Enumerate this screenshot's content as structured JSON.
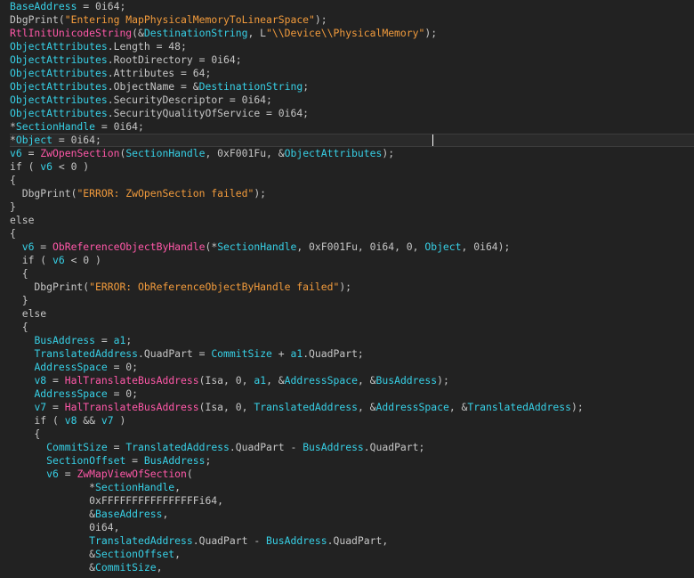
{
  "lines": [
    [
      [
        "BaseAddress",
        "var"
      ],
      [
        " = 0i64;",
        "plain"
      ]
    ],
    [
      [
        "DbgPrint",
        "plain"
      ],
      [
        "(",
        "plain"
      ],
      [
        "\"Entering MapPhysicalMemoryToLinearSpace\"",
        "str"
      ],
      [
        ");",
        "plain"
      ]
    ],
    [
      [
        "RtlInitUnicodeString",
        "func"
      ],
      [
        "(&",
        "plain"
      ],
      [
        "DestinationString",
        "var"
      ],
      [
        ", L",
        "plain"
      ],
      [
        "\"\\\\Device\\\\PhysicalMemory\"",
        "str"
      ],
      [
        ");",
        "plain"
      ]
    ],
    [
      [
        "ObjectAttributes",
        "var"
      ],
      [
        ".Length = 48;",
        "plain"
      ]
    ],
    [
      [
        "ObjectAttributes",
        "var"
      ],
      [
        ".RootDirectory = 0i64;",
        "plain"
      ]
    ],
    [
      [
        "ObjectAttributes",
        "var"
      ],
      [
        ".Attributes = 64;",
        "plain"
      ]
    ],
    [
      [
        "ObjectAttributes",
        "var"
      ],
      [
        ".ObjectName = &",
        "plain"
      ],
      [
        "DestinationString",
        "var"
      ],
      [
        ";",
        "plain"
      ]
    ],
    [
      [
        "ObjectAttributes",
        "var"
      ],
      [
        ".SecurityDescriptor = 0i64;",
        "plain"
      ]
    ],
    [
      [
        "ObjectAttributes",
        "var"
      ],
      [
        ".SecurityQualityOfService = 0i64;",
        "plain"
      ]
    ],
    [
      [
        "*",
        "plain"
      ],
      [
        "SectionHandle",
        "var"
      ],
      [
        " = 0i64;",
        "plain"
      ]
    ],
    [
      [
        "*",
        "plain"
      ],
      [
        "Object",
        "var"
      ],
      [
        " = 0i64;",
        "plain"
      ]
    ],
    [
      [
        "v6",
        "var"
      ],
      [
        " = ",
        "plain"
      ],
      [
        "ZwOpenSection",
        "func"
      ],
      [
        "(",
        "plain"
      ],
      [
        "SectionHandle",
        "var"
      ],
      [
        ", 0xF001Fu, &",
        "plain"
      ],
      [
        "ObjectAttributes",
        "var"
      ],
      [
        ");",
        "plain"
      ]
    ],
    [
      [
        "if ( ",
        "plain"
      ],
      [
        "v6",
        "var"
      ],
      [
        " < 0 )",
        "plain"
      ]
    ],
    [
      [
        "{",
        "plain"
      ]
    ],
    [
      [
        "  DbgPrint(",
        "plain"
      ],
      [
        "\"ERROR: ZwOpenSection failed\"",
        "str"
      ],
      [
        ");",
        "plain"
      ]
    ],
    [
      [
        "}",
        "plain"
      ]
    ],
    [
      [
        "else",
        "plain"
      ]
    ],
    [
      [
        "{",
        "plain"
      ]
    ],
    [
      [
        "  ",
        "plain"
      ],
      [
        "v6",
        "var"
      ],
      [
        " = ",
        "plain"
      ],
      [
        "ObReferenceObjectByHandle",
        "func"
      ],
      [
        "(*",
        "plain"
      ],
      [
        "SectionHandle",
        "var"
      ],
      [
        ", 0xF001Fu, 0i64, 0, ",
        "plain"
      ],
      [
        "Object",
        "var"
      ],
      [
        ", 0i64);",
        "plain"
      ]
    ],
    [
      [
        "  if ( ",
        "plain"
      ],
      [
        "v6",
        "var"
      ],
      [
        " < 0 )",
        "plain"
      ]
    ],
    [
      [
        "  {",
        "plain"
      ]
    ],
    [
      [
        "    DbgPrint(",
        "plain"
      ],
      [
        "\"ERROR: ObReferenceObjectByHandle failed\"",
        "str"
      ],
      [
        ");",
        "plain"
      ]
    ],
    [
      [
        "  }",
        "plain"
      ]
    ],
    [
      [
        "  else",
        "plain"
      ]
    ],
    [
      [
        "  {",
        "plain"
      ]
    ],
    [
      [
        "    ",
        "plain"
      ],
      [
        "BusAddress",
        "var"
      ],
      [
        " = ",
        "plain"
      ],
      [
        "a1",
        "var"
      ],
      [
        ";",
        "plain"
      ]
    ],
    [
      [
        "    ",
        "plain"
      ],
      [
        "TranslatedAddress",
        "var"
      ],
      [
        ".QuadPart = ",
        "plain"
      ],
      [
        "CommitSize",
        "var"
      ],
      [
        " + ",
        "plain"
      ],
      [
        "a1",
        "var"
      ],
      [
        ".QuadPart;",
        "plain"
      ]
    ],
    [
      [
        "    ",
        "plain"
      ],
      [
        "AddressSpace",
        "var"
      ],
      [
        " = 0;",
        "plain"
      ]
    ],
    [
      [
        "    ",
        "plain"
      ],
      [
        "v8",
        "var"
      ],
      [
        " = ",
        "plain"
      ],
      [
        "HalTranslateBusAddress",
        "func"
      ],
      [
        "(Isa, 0, ",
        "plain"
      ],
      [
        "a1",
        "var"
      ],
      [
        ", &",
        "plain"
      ],
      [
        "AddressSpace",
        "var"
      ],
      [
        ", &",
        "plain"
      ],
      [
        "BusAddress",
        "var"
      ],
      [
        ");",
        "plain"
      ]
    ],
    [
      [
        "    ",
        "plain"
      ],
      [
        "AddressSpace",
        "var"
      ],
      [
        " = 0;",
        "plain"
      ]
    ],
    [
      [
        "    ",
        "plain"
      ],
      [
        "v7",
        "var"
      ],
      [
        " = ",
        "plain"
      ],
      [
        "HalTranslateBusAddress",
        "func"
      ],
      [
        "(Isa, 0, ",
        "plain"
      ],
      [
        "TranslatedAddress",
        "var"
      ],
      [
        ", &",
        "plain"
      ],
      [
        "AddressSpace",
        "var"
      ],
      [
        ", &",
        "plain"
      ],
      [
        "TranslatedAddress",
        "var"
      ],
      [
        ");",
        "plain"
      ]
    ],
    [
      [
        "    if ( ",
        "plain"
      ],
      [
        "v8",
        "var"
      ],
      [
        " && ",
        "plain"
      ],
      [
        "v7",
        "var"
      ],
      [
        " )",
        "plain"
      ]
    ],
    [
      [
        "    {",
        "plain"
      ]
    ],
    [
      [
        "      ",
        "plain"
      ],
      [
        "CommitSize",
        "var"
      ],
      [
        " = ",
        "plain"
      ],
      [
        "TranslatedAddress",
        "var"
      ],
      [
        ".QuadPart - ",
        "plain"
      ],
      [
        "BusAddress",
        "var"
      ],
      [
        ".QuadPart;",
        "plain"
      ]
    ],
    [
      [
        "      ",
        "plain"
      ],
      [
        "SectionOffset",
        "var"
      ],
      [
        " = ",
        "plain"
      ],
      [
        "BusAddress",
        "var"
      ],
      [
        ";",
        "plain"
      ]
    ],
    [
      [
        "      ",
        "plain"
      ],
      [
        "v6",
        "var"
      ],
      [
        " = ",
        "plain"
      ],
      [
        "ZwMapViewOfSection",
        "func"
      ],
      [
        "(",
        "plain"
      ]
    ],
    [
      [
        "             *",
        "plain"
      ],
      [
        "SectionHandle",
        "var"
      ],
      [
        ",",
        "plain"
      ]
    ],
    [
      [
        "             0xFFFFFFFFFFFFFFFFi64,",
        "plain"
      ]
    ],
    [
      [
        "             &",
        "plain"
      ],
      [
        "BaseAddress",
        "var"
      ],
      [
        ",",
        "plain"
      ]
    ],
    [
      [
        "             0i64,",
        "plain"
      ]
    ],
    [
      [
        "             ",
        "plain"
      ],
      [
        "TranslatedAddress",
        "var"
      ],
      [
        ".QuadPart - ",
        "plain"
      ],
      [
        "BusAddress",
        "var"
      ],
      [
        ".QuadPart,",
        "plain"
      ]
    ],
    [
      [
        "             &",
        "plain"
      ],
      [
        "SectionOffset",
        "var"
      ],
      [
        ",",
        "plain"
      ]
    ],
    [
      [
        "             &",
        "plain"
      ],
      [
        "CommitSize",
        "var"
      ],
      [
        ",",
        "plain"
      ]
    ]
  ],
  "current_line": 10,
  "colors": {
    "background": "#222222",
    "identifier": "#37d0e6",
    "function": "#ff58a8",
    "string": "#f29b3c",
    "plain": "#c6c6c6"
  }
}
